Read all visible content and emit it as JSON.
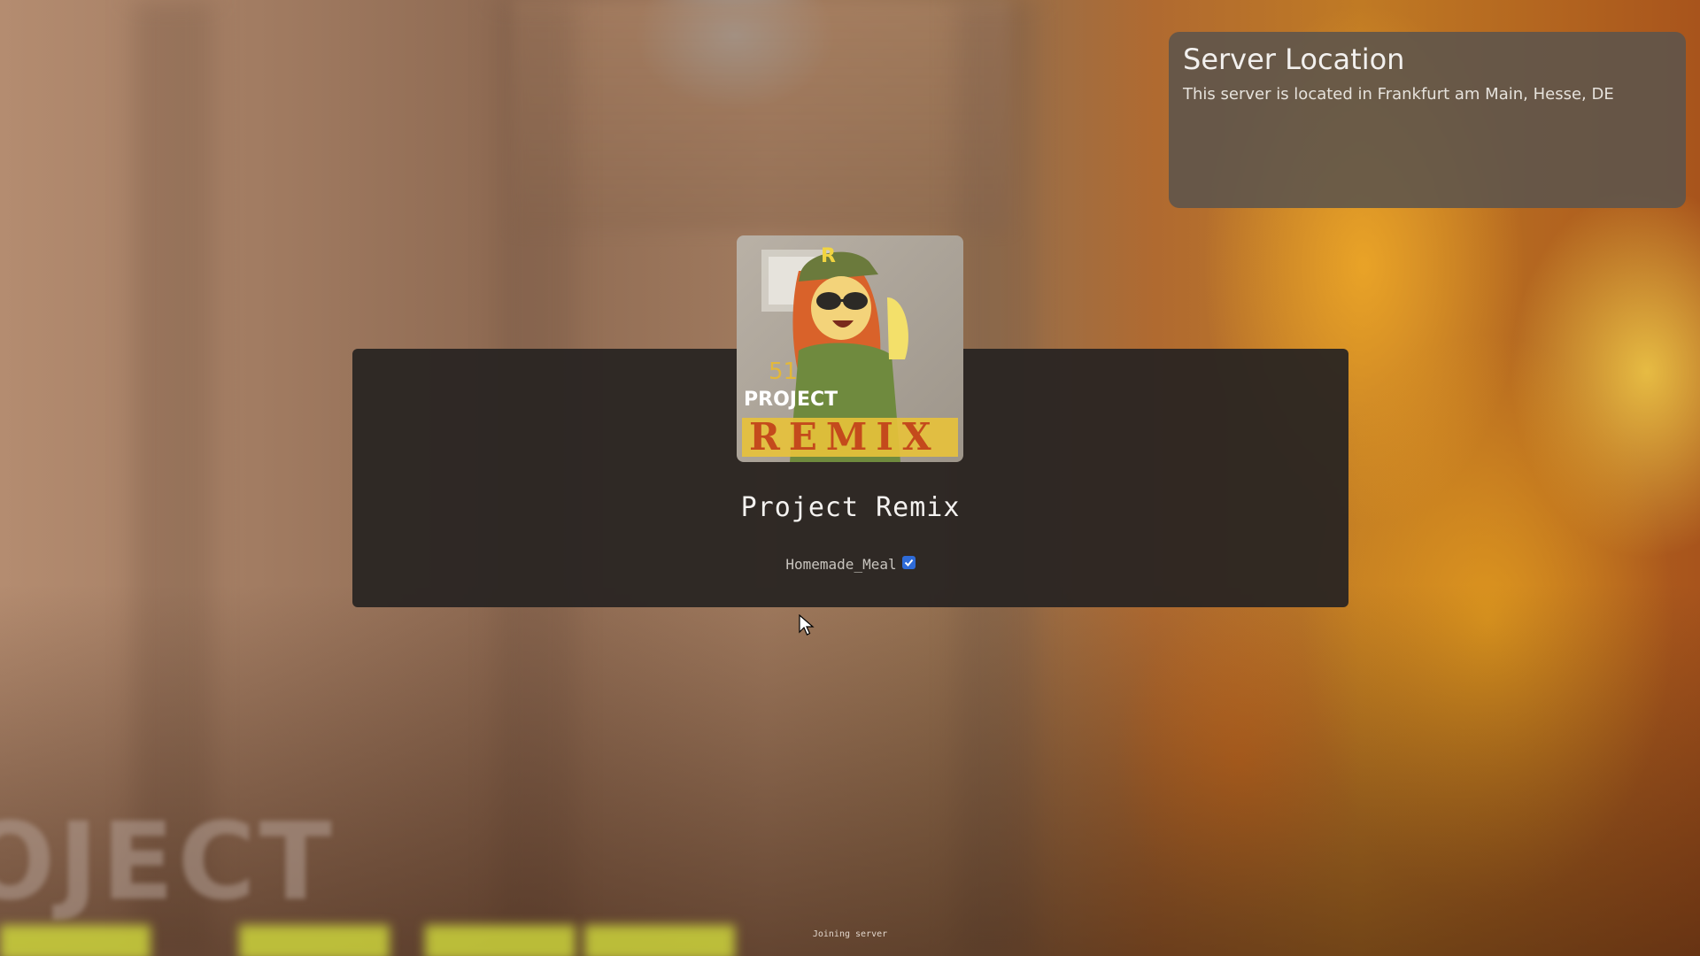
{
  "server_location": {
    "title": "Server Location",
    "description": "This server is located in Frankfurt am Main, Hesse, DE"
  },
  "server": {
    "name": "Project Remix",
    "owner": "Homemade_Meal",
    "owner_verified": true,
    "icon": "project-remix-logo",
    "icon_text_top": "PROJECT",
    "icon_text_bottom": "REMIX",
    "icon_badge": "51"
  },
  "status": {
    "text": "Joining server"
  },
  "background": {
    "watermark_text": "OJECT"
  },
  "colors": {
    "verified_badge": "#2e6bd8",
    "panel": "#282422",
    "location_card": "#5c544c"
  }
}
